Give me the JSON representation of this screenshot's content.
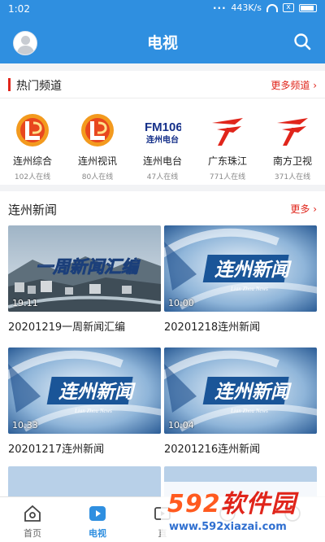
{
  "status": {
    "time": "1:02",
    "dots": "···",
    "speed": "443K/s",
    "box_char": "x"
  },
  "header": {
    "title": "电视"
  },
  "hot": {
    "title": "热门频道",
    "more": "更多频道 ›",
    "channels": [
      {
        "name": "连州综合",
        "count": "102人在线",
        "icon": "lianzhou-logo-icon"
      },
      {
        "name": "连州视讯",
        "count": "80人在线",
        "icon": "lianzhou-logo-icon"
      },
      {
        "name": "连州电台",
        "count": "47人在线",
        "icon": "fm106-logo-icon",
        "logo_main": "FM106",
        "logo_sub": "连州电台"
      },
      {
        "name": "广东珠江",
        "count": "771人在线",
        "icon": "guangdong-tv-logo-icon"
      },
      {
        "name": "南方卫视",
        "count": "371人在线",
        "icon": "guangdong-tv-logo-icon"
      }
    ]
  },
  "news": {
    "title": "连州新闻",
    "more": "更多 ›",
    "items": [
      {
        "title": "20201219一周新闻汇编",
        "duration": "19:11",
        "overlay": "一周新闻汇编"
      },
      {
        "title": "20201218连州新闻",
        "duration": "10:00",
        "overlay": "连州新闻",
        "overlay_sub": "Lian Zhou News"
      },
      {
        "title": "20201217连州新闻",
        "duration": "10:33",
        "overlay": "连州新闻",
        "overlay_sub": "Lian Zhou News"
      },
      {
        "title": "20201216连州新闻",
        "duration": "10:04",
        "overlay": "连州新闻",
        "overlay_sub": "Lian Zhou News"
      }
    ]
  },
  "tabs": [
    {
      "label": "首页",
      "icon": "home-icon"
    },
    {
      "label": "电视",
      "icon": "tv-play-icon",
      "active": true
    },
    {
      "label": "直",
      "icon": "live-icon"
    },
    {
      "label": "",
      "icon": "tab-icon-4"
    },
    {
      "label": "",
      "icon": "tab-icon-5"
    }
  ],
  "watermark": {
    "logo_num": "592",
    "logo_text": "软件园",
    "url": "www.592xiazai.com"
  },
  "colors": {
    "primary": "#2f8fe0",
    "accent": "#e0251b"
  }
}
